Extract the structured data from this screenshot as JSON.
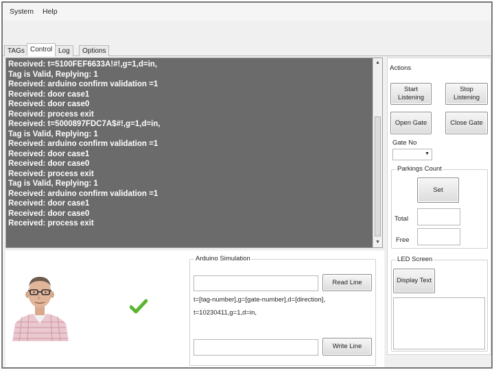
{
  "menu": {
    "system": "System",
    "help": "Help"
  },
  "tabs": [
    {
      "label": "TAGs",
      "active": false
    },
    {
      "label": "Control",
      "active": true
    },
    {
      "label": "Log",
      "active": false
    },
    {
      "label": "Options",
      "active": false
    }
  ],
  "log": {
    "lines": [
      "Received: t=5100FEF6633A!#!,g=1,d=in,",
      "Tag is Valid, Replying: 1",
      "Received: arduino confirm validation =1",
      "Received: door case1",
      "Received: door case0",
      "Received: process exit",
      "Received: t=5000897FDC7A$#!,g=1,d=in,",
      "Tag is Valid, Replying: 1",
      "Received: arduino confirm validation =1",
      "Received: door case1",
      "Received: door case0",
      "Received: process exit",
      "Tag is Valid, Replying: 1",
      "Received: arduino confirm validation =1",
      "Received: door case1",
      "Received: door case0",
      "Received: process exit"
    ],
    "background": "#6b6b6b"
  },
  "actions": {
    "title": "Actions",
    "start_listening": "Start Listening",
    "stop_listening": "Stop Listening",
    "open_gate": "Open Gate",
    "close_gate": "Close Gate",
    "gate_no_label": "Gate No",
    "gate_no_value": "",
    "parkings_count_title": "Parkings Count",
    "set_button": "Set",
    "total_label": "Total",
    "total_value": "",
    "free_label": "Free",
    "free_value": ""
  },
  "led_screen": {
    "title": "LED Screen",
    "display_text_button": "Display Text",
    "text": ""
  },
  "arduino_simulation": {
    "title": "Arduino Simulation",
    "read_input_value": "",
    "read_line_button": "Read Line",
    "format_text": "t=[tag-number],g=[gate-number],d=[direction],",
    "example_text": "t=10230411,g=1,d=in,",
    "write_input_value": "",
    "write_line_button": "Write Line"
  },
  "status": {
    "check_icon": "green-checkmark-icon",
    "check_color": "#5ab52f"
  },
  "user": {
    "avatar_icon": "user-portrait-icon"
  }
}
